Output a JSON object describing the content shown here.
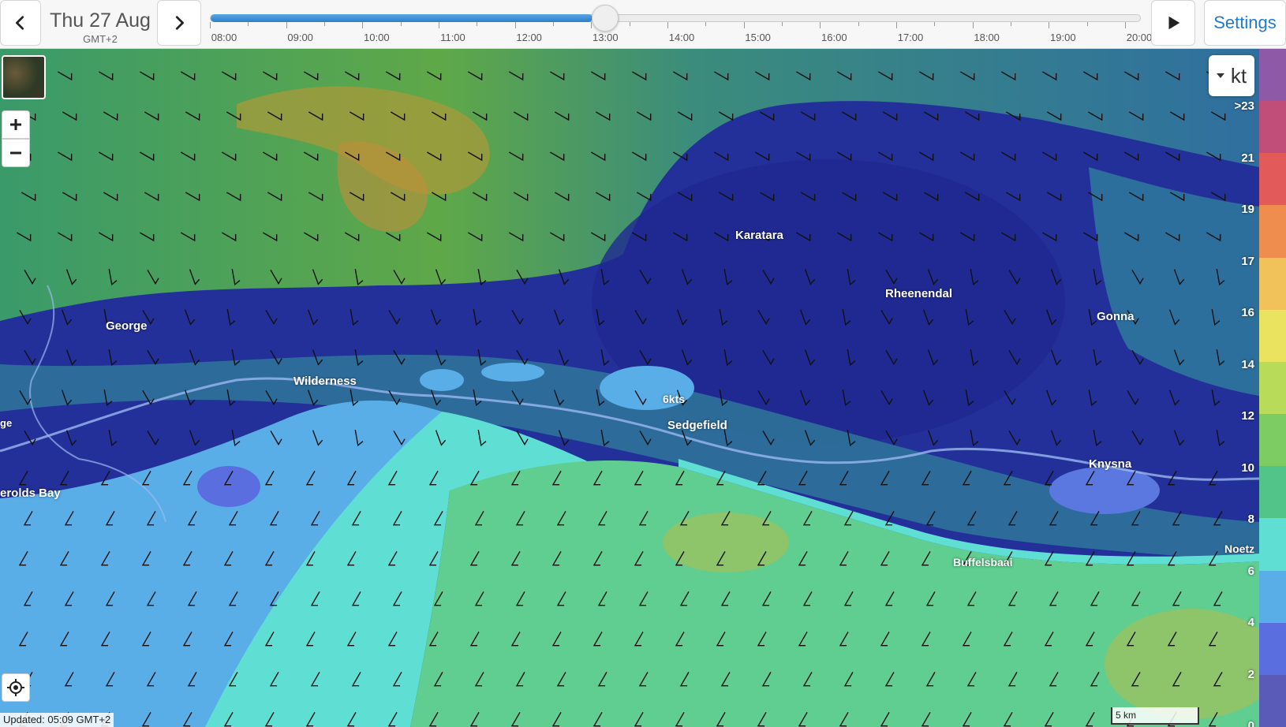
{
  "topbar": {
    "prev_icon": "chevron-left-icon",
    "next_icon": "chevron-right-icon",
    "play_icon": "play-icon",
    "date": "Thu 27 Aug",
    "timezone": "GMT+2",
    "settings_label": "Settings",
    "timeline": {
      "hours": [
        "08:00",
        "09:00",
        "10:00",
        "11:00",
        "12:00",
        "13:00",
        "14:00",
        "15:00",
        "16:00",
        "17:00",
        "18:00",
        "19:00",
        "20:00"
      ],
      "current": "13:00",
      "progress": 0.41
    }
  },
  "map": {
    "places": [
      {
        "id": "karatara",
        "name": "Karatara"
      },
      {
        "id": "rheenendal",
        "name": "Rheenendal"
      },
      {
        "id": "gonna",
        "name": "Gonna"
      },
      {
        "id": "george",
        "name": "George"
      },
      {
        "id": "wilderness",
        "name": "Wilderness"
      },
      {
        "id": "sedgefield",
        "name": "Sedgefield"
      },
      {
        "id": "knysna",
        "name": "Knysna"
      },
      {
        "id": "herolds-bay",
        "name": "erolds Bay"
      },
      {
        "id": "george-edge",
        "name": "ge"
      },
      {
        "id": "buffelsbaai",
        "name": "Buffelsbaai"
      },
      {
        "id": "noetzie",
        "name": "Noetz"
      },
      {
        "id": "wind-label",
        "name": "6kts"
      }
    ],
    "unit": "kt",
    "legend": {
      "labels": [
        ">23",
        "21",
        "19",
        "17",
        "16",
        "14",
        "12",
        "10",
        "8",
        "6",
        "4",
        "2",
        "0"
      ],
      "colors": [
        "#8e5aa8",
        "#c04e78",
        "#e35a5a",
        "#ee8d4e",
        "#f2c25a",
        "#e9e35f",
        "#b8dc5a",
        "#7ccc63",
        "#52c48a",
        "#5fdfd3",
        "#5aaee8",
        "#5a6ee0",
        "#5a5ab8"
      ]
    },
    "updated": "Updated: 05:09 GMT+2",
    "scale": "5 km"
  }
}
